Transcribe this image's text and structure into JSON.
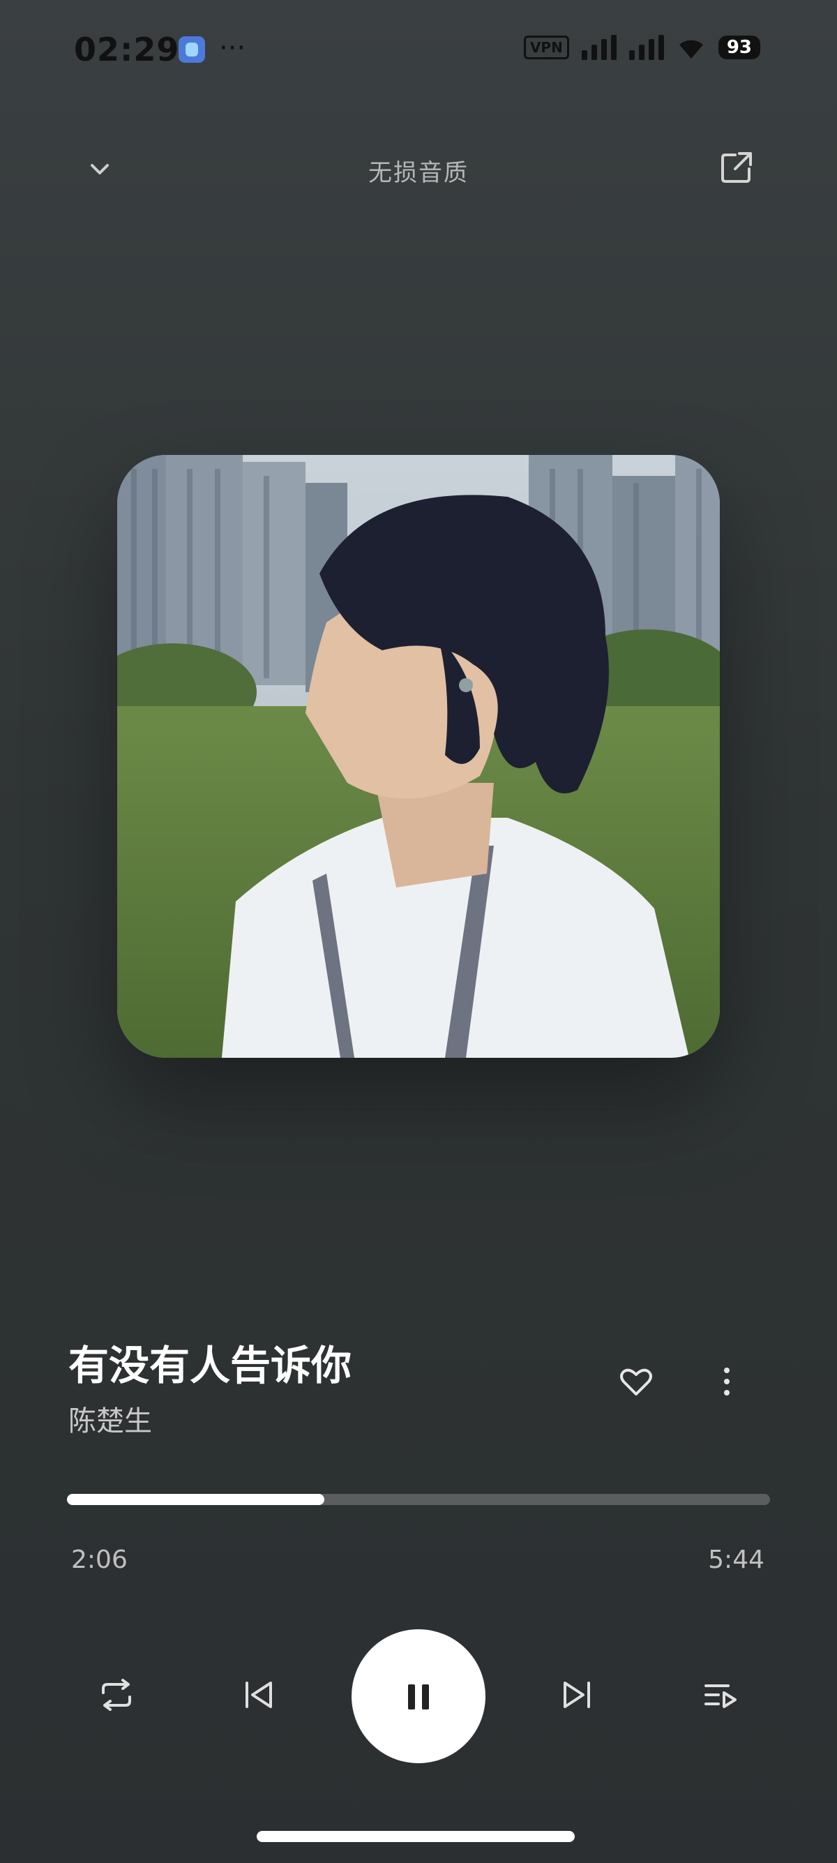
{
  "status_bar": {
    "time": "02:29",
    "more": "···",
    "vpn": "VPN",
    "battery": "93"
  },
  "header": {
    "quality_label": "无损音质",
    "collapse_icon": "chevron-down-icon",
    "share_icon": "share-icon"
  },
  "track": {
    "title": "有没有人告诉你",
    "artist": "陈楚生",
    "favorite_icon": "heart-icon",
    "more_icon": "more-vertical-icon"
  },
  "progress": {
    "current": "2:06",
    "total": "5:44",
    "fraction": 0.366
  },
  "controls": {
    "repeat_icon": "repeat-icon",
    "previous_icon": "previous-icon",
    "play_pause_icon": "pause-icon",
    "next_icon": "next-icon",
    "queue_icon": "playlist-icon"
  },
  "colors": {
    "accent": "#ffffff",
    "track_bg": "#5a5e5e",
    "background": "#2f3434"
  }
}
